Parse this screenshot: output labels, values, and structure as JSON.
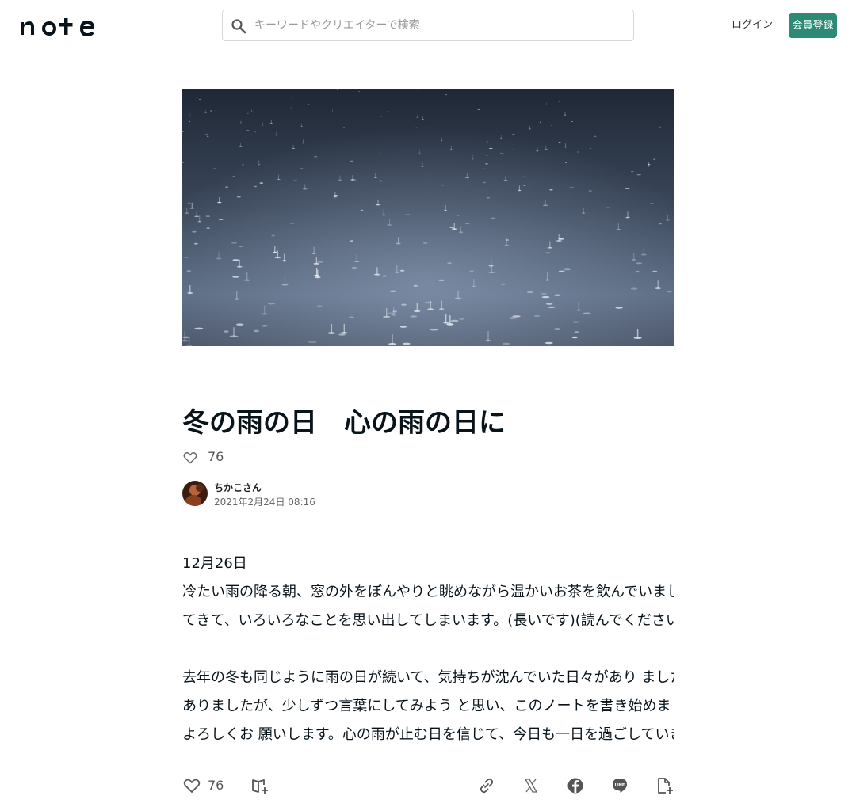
{
  "header": {
    "logo_text": "note",
    "search_placeholder": "キーワードやクリエイターで検索",
    "login_label": "ログイン",
    "signup_label": "会員登録"
  },
  "article": {
    "title": "冬の雨の日　心の雨の日に",
    "like_count": "76",
    "author_name": "ちかこさん",
    "date": "2021年2月24日 08:16",
    "lines": [
      "12月26日",
      "冷たい雨の降る朝、窓の外をぼんやりと眺めながら温かいお茶を飲んでいました。 雨の音を聞いていると心が少しずつ落ち着い",
      "てきて、いろいろなことを思い出してしまいます。(長いです)(読んでくださいね)",
      "",
      "去年の冬も同じように雨の日が続いて、気持ちが沈んでいた日々があり ました。誰にも話せずに一人で抱えていたことがたくさん",
      "ありましたが、少しずつ言葉にしてみよう と思い、このノートを書き始めました。同じような気持ちの方に届いたら嬉しいです。",
      "よろしくお 願いします。心の雨が止む日を信じて、今日も一日を過ごしていきます。"
    ]
  },
  "bottom_bar": {
    "like_count": "76",
    "icons": [
      "heart-icon",
      "magazine-add-icon",
      "link-icon",
      "x-icon",
      "facebook-icon",
      "line-icon",
      "note-add-icon"
    ]
  },
  "colors": {
    "accent": "#2d8a74",
    "text": "#08131a",
    "hero_base": "#2a3442"
  }
}
